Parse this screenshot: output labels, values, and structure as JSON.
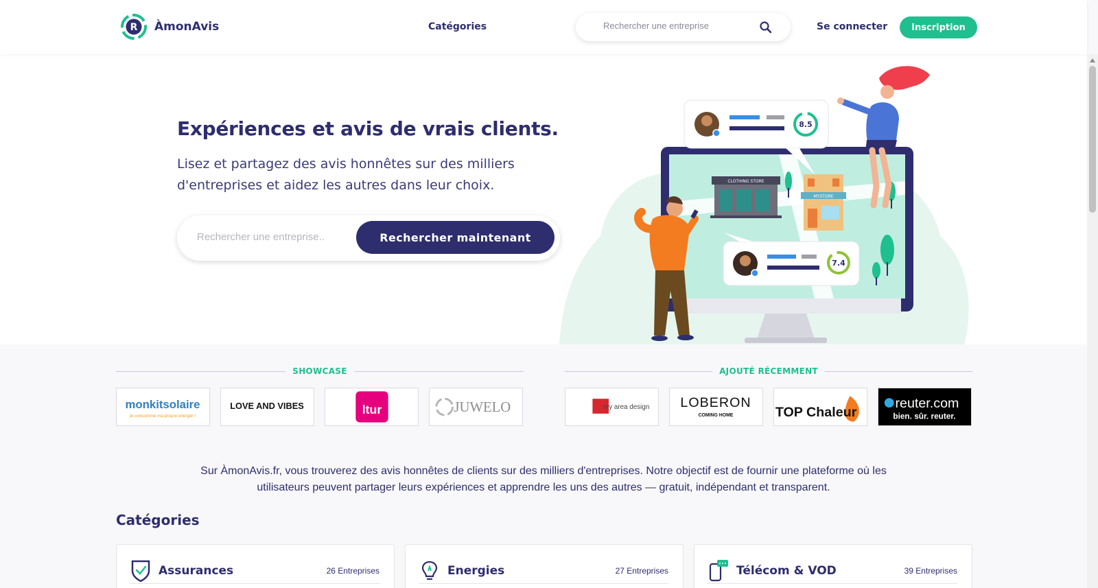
{
  "brand": {
    "name": "ÀmonAvis",
    "accent": "#1fbf8f",
    "primary": "#2e2d6e"
  },
  "header": {
    "nav_categories": "Catégories",
    "search_placeholder": "Rechercher une entreprise",
    "login": "Se connecter",
    "signup": "Inscription"
  },
  "hero": {
    "title": "Expériences et avis de vrais clients.",
    "subtitle": "Lisez et partagez des avis honnêtes sur des milliers d'entreprises et aidez les autres dans leur choix.",
    "search_placeholder": "Rechercher une entreprise..",
    "search_button": "Rechercher maintenant",
    "illustration": {
      "store_sign_1": "CLOTHING STORE",
      "store_sign_2": "MYSTORE",
      "review_score_1": "8.5",
      "review_score_2": "7.4"
    }
  },
  "showcase": {
    "label": "SHOWCASE",
    "logos": [
      {
        "name": "monkitsolaire",
        "text": "monkitsolaire",
        "tagline": "je consomme ma propre énergie !"
      },
      {
        "name": "love-and-vibes",
        "text": "LOVE AND VIBES"
      },
      {
        "name": "ltur",
        "text": "ltur"
      },
      {
        "name": "juwelo",
        "text": "JUWELO"
      }
    ]
  },
  "recent": {
    "label": "AJOUTÉ RÉCEMMENT",
    "logos": [
      {
        "name": "my-area-design",
        "text": "my area design"
      },
      {
        "name": "loberon",
        "text": "LOBERON",
        "tagline": "COMING HOME"
      },
      {
        "name": "top-chaleur",
        "text": "TOP Chaleur"
      },
      {
        "name": "reuter",
        "text": "reuter.com",
        "tagline": "bien. sûr. reuter."
      }
    ]
  },
  "about": "Sur ÀmonAvis.fr, vous trouverez des avis honnêtes de clients sur des milliers d'entreprises. Notre objectif est de fournir une plateforme où les utilisateurs peuvent partager leurs expériences et apprendre les uns des autres — gratuit, indépendant et transparent.",
  "categories": {
    "heading": "Catégories",
    "items": [
      {
        "name": "Assurances",
        "count": "26 Entreprises",
        "icon": "shield-check-icon"
      },
      {
        "name": "Energies",
        "count": "27 Entreprises",
        "icon": "lightbulb-icon"
      },
      {
        "name": "Télécom & VOD",
        "count": "39 Entreprises",
        "icon": "phone-chat-icon"
      }
    ]
  }
}
